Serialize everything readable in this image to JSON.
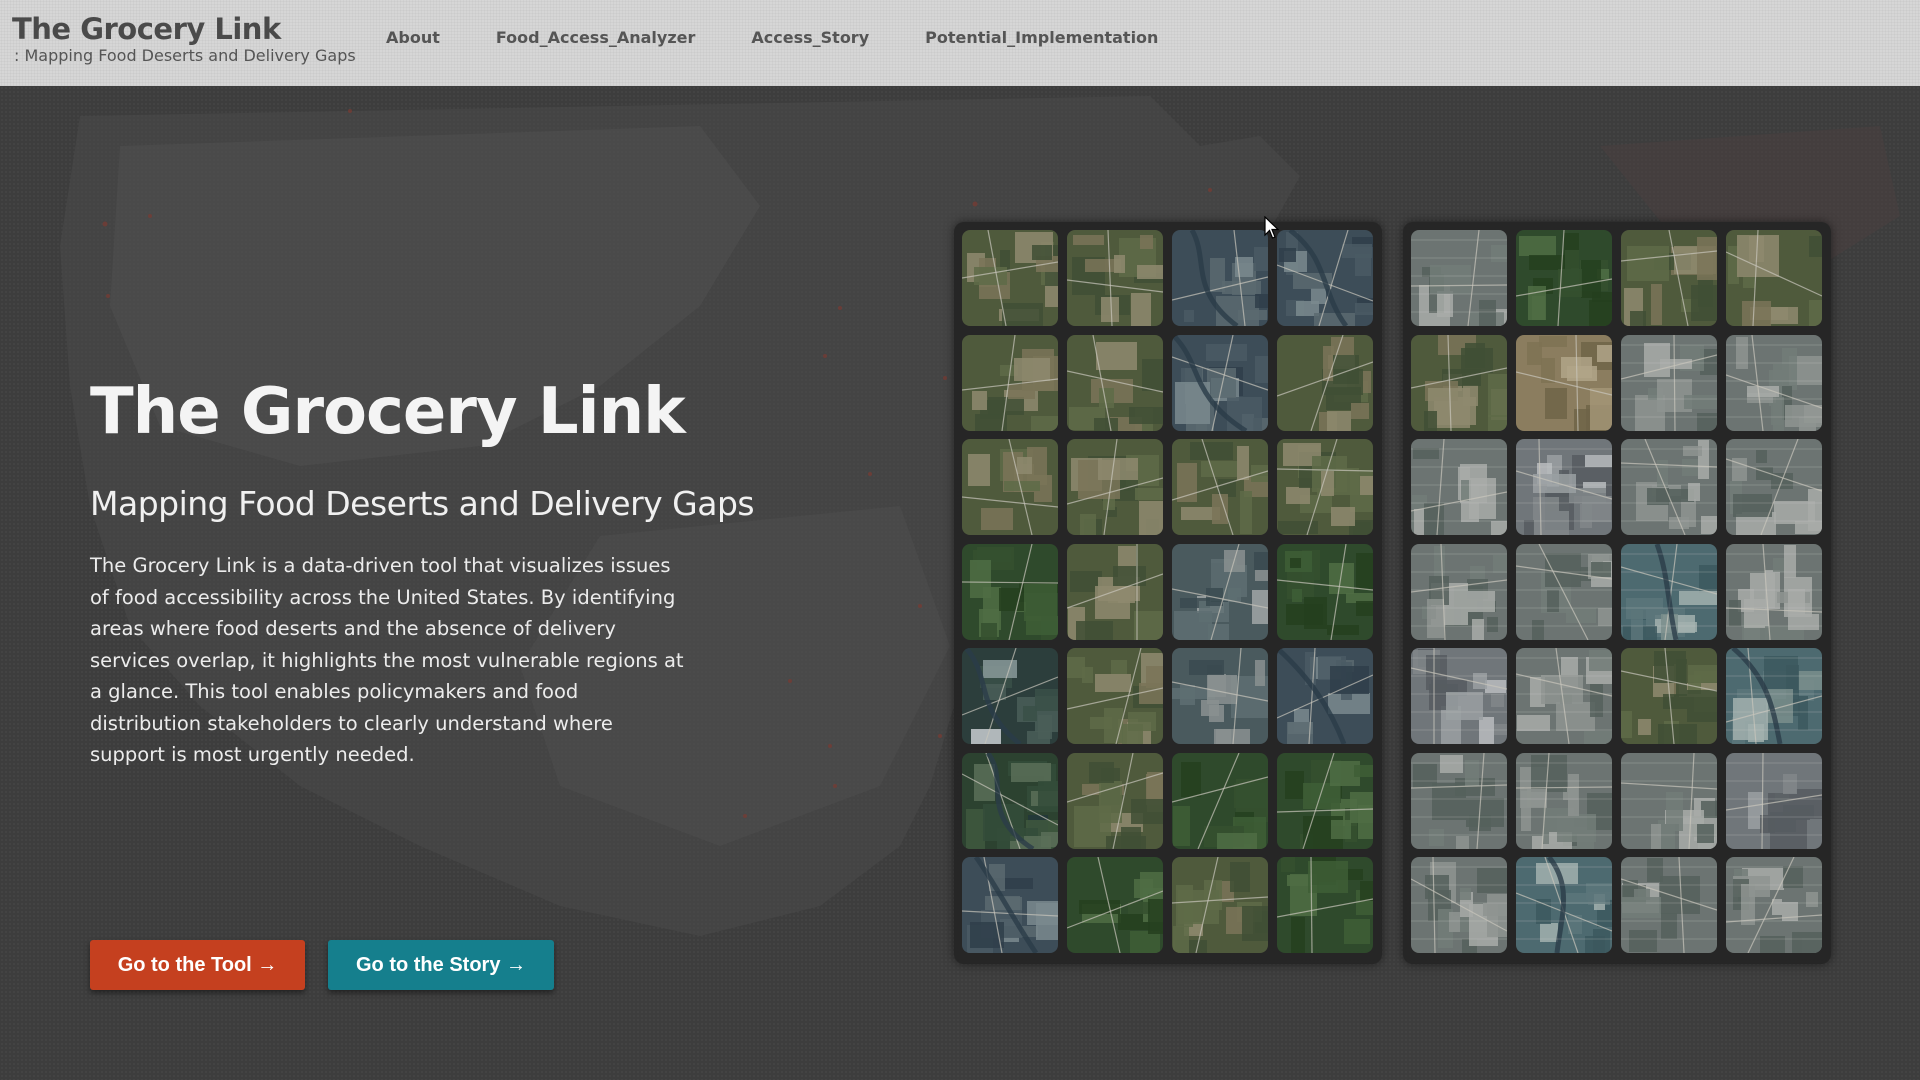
{
  "nav": {
    "brand_title": "The Grocery Link",
    "brand_subtitle": ": Mapping Food Deserts and Delivery Gaps",
    "links": [
      "About",
      "Food_Access_Analyzer",
      "Access_Story",
      "Potential_Implementation"
    ]
  },
  "hero": {
    "title": "The Grocery Link",
    "subtitle": "Mapping Food Deserts and Delivery Gaps",
    "description": "The Grocery Link is a data-driven tool that visualizes issues of food accessibility across the United States. By identifying areas where food deserts and the absence of delivery services overlap, it highlights the most vulnerable regions at a glance. This tool enables policymakers and food distribution stakeholders to clearly understand where support is most urgently needed.",
    "btn_tool": "Go to the Tool →",
    "btn_story": "Go to the Story →"
  },
  "colors": {
    "tool_button": "#c5401f",
    "story_button": "#157f8d",
    "nav_bg": "#d6d6d6",
    "hero_bg": "#3d3d3d"
  },
  "tiles": {
    "left_panel": [
      "rural-farmland",
      "rural-farmland",
      "river-town",
      "river-town",
      "rural-farmland",
      "rural-farmland",
      "river-town",
      "rural-farmland",
      "rural-farmland",
      "rural-farmland",
      "rural-farmland",
      "rural-farmland",
      "forest",
      "rural-farmland",
      "small-town",
      "forest",
      "lake-town",
      "rural-farmland",
      "small-town",
      "river-town",
      "lake-forest",
      "rural-farmland",
      "forest",
      "forest",
      "river-town",
      "forest",
      "rural-farmland",
      "forest"
    ],
    "right_panel": [
      "suburb",
      "forest",
      "rural-farmland",
      "rural-farmland",
      "rural-farmland",
      "farm-fields",
      "suburb",
      "suburb",
      "suburb",
      "industrial",
      "suburb",
      "suburb",
      "suburb",
      "suburb",
      "river-city",
      "suburb",
      "industrial",
      "suburb",
      "rural-farmland",
      "river-city",
      "suburb",
      "suburb",
      "suburb",
      "industrial",
      "suburb",
      "river-city",
      "suburb",
      "suburb"
    ]
  }
}
